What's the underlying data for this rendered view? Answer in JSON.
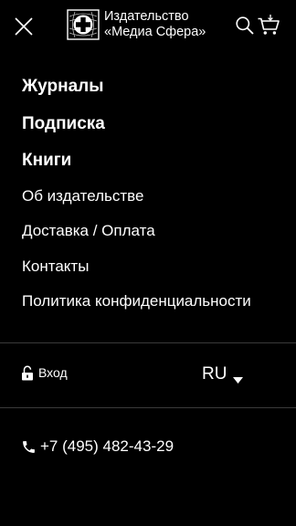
{
  "header": {
    "close_icon": "close-icon",
    "logo": {
      "icon": "publisher-emblem-icon",
      "line1": "Издательство",
      "line2": "«Медиа Сфера»"
    },
    "search_icon": "search-icon",
    "cart_icon": "cart-icon"
  },
  "menu": {
    "primary": [
      {
        "label": "Журналы"
      },
      {
        "label": "Подписка"
      },
      {
        "label": "Книги"
      }
    ],
    "secondary": [
      {
        "label": "Об издательстве"
      },
      {
        "label": "Доставка / Оплата"
      },
      {
        "label": "Контакты"
      },
      {
        "label": "Политика конфиденциальности"
      }
    ]
  },
  "account": {
    "icon": "lock-icon",
    "login_label": "Вход"
  },
  "language": {
    "current": "RU",
    "icon": "caret-down-icon"
  },
  "contact": {
    "icon": "phone-icon",
    "phone": "+7 (495) 482-43-29"
  },
  "colors": {
    "background": "#000000",
    "text": "#ffffff",
    "divider": "#3a3a3a"
  }
}
